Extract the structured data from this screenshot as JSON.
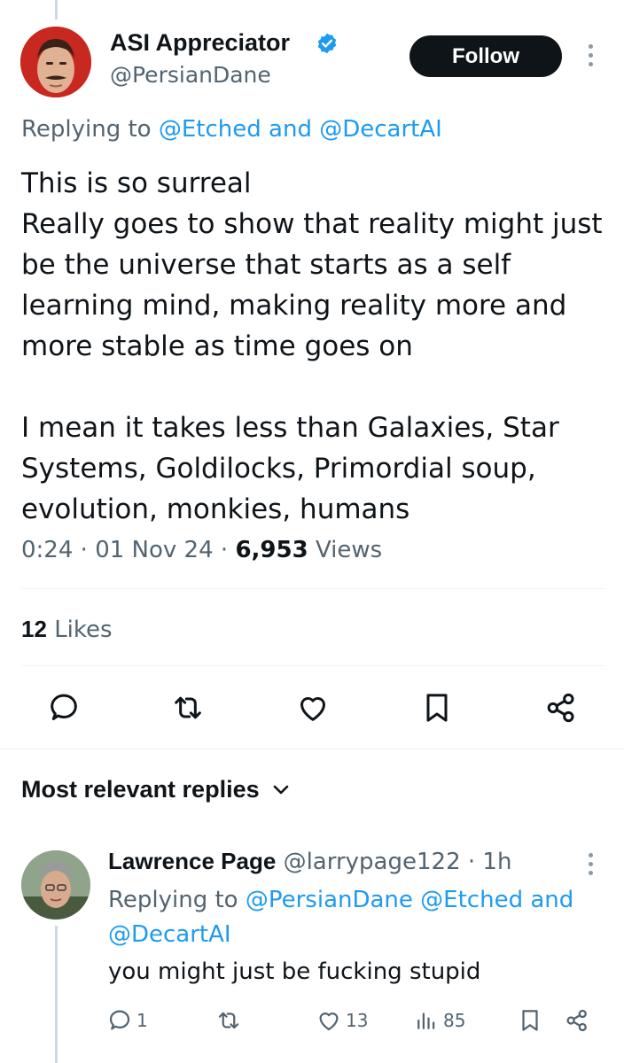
{
  "tweet": {
    "author_name": "ASI Appreciator",
    "handle": "@PersianDane",
    "follow_label": "Follow",
    "replying_prefix": "Replying to",
    "replying_to_1": "@Etched",
    "replying_and": "and",
    "replying_to_2": "@DecartAI",
    "text_line1": "This is so surreal",
    "text_line2": "Really goes to show that reality might just be the universe that starts as a self learning mind, making reality more and more stable as time goes on",
    "text_line3": "I mean it takes less than Galaxies, Star Systems, Goldilocks, Primordial soup, evolution, monkies, humans",
    "time": "0:24",
    "date": "01 Nov 24",
    "views_count": "6,953",
    "views_label": "Views",
    "likes_count": "12",
    "likes_label": "Likes"
  },
  "actions": [
    "reply-icon",
    "retweet-icon",
    "like-icon",
    "bookmark-icon",
    "share-icon"
  ],
  "replies_section": {
    "title": "Most relevant replies"
  },
  "reply": {
    "author_name": "Lawrence Page",
    "handle": "@larrypage122",
    "time": "1h",
    "replying_prefix": "Replying to",
    "replying_to_1": "@PersianDane",
    "replying_to_2": "@Etched",
    "replying_and": "and",
    "replying_to_3": "@DecartAI",
    "text": "you might just be fucking stupid",
    "reply_count": "1",
    "like_count": "13",
    "views_count": "85"
  },
  "colors": {
    "text": "#0f1419",
    "muted": "#536471",
    "link": "#1d9bf0",
    "verified": "#1d9bf0",
    "divider": "#eff3f4"
  }
}
